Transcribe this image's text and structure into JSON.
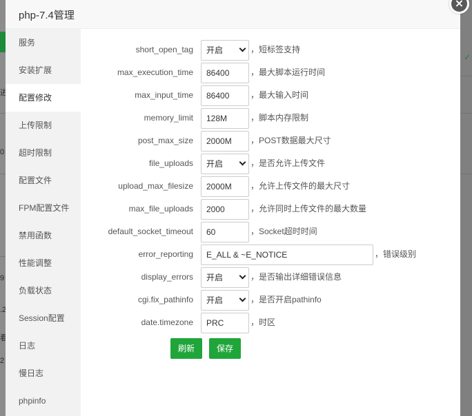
{
  "title": "php-7.4管理",
  "close_symbol": "×",
  "sidebar": {
    "items": [
      {
        "label": "服务"
      },
      {
        "label": "安装扩展"
      },
      {
        "label": "配置修改"
      },
      {
        "label": "上传限制"
      },
      {
        "label": "超时限制"
      },
      {
        "label": "配置文件"
      },
      {
        "label": "FPM配置文件"
      },
      {
        "label": "禁用函数"
      },
      {
        "label": "性能调整"
      },
      {
        "label": "负载状态"
      },
      {
        "label": "Session配置"
      },
      {
        "label": "日志"
      },
      {
        "label": "慢日志"
      },
      {
        "label": "phpinfo"
      }
    ],
    "active": "配置修改"
  },
  "settings": [
    {
      "label": "short_open_tag",
      "value": "开启",
      "type": "select",
      "desc": "，短标签支持"
    },
    {
      "label": "max_execution_time",
      "value": "86400",
      "type": "input",
      "desc": "，最大脚本运行时间"
    },
    {
      "label": "max_input_time",
      "value": "86400",
      "type": "input",
      "desc": "，最大输入时间"
    },
    {
      "label": "memory_limit",
      "value": "128M",
      "type": "input",
      "desc": "，脚本内存限制"
    },
    {
      "label": "post_max_size",
      "value": "2000M",
      "type": "input",
      "desc": "，POST数据最大尺寸"
    },
    {
      "label": "file_uploads",
      "value": "开启",
      "type": "select",
      "desc": "，是否允许上传文件"
    },
    {
      "label": "upload_max_filesize",
      "value": "2000M",
      "type": "input",
      "desc": "，允许上传文件的最大尺寸"
    },
    {
      "label": "max_file_uploads",
      "value": "2000",
      "type": "input",
      "desc": "，允许同时上传文件的最大数量"
    },
    {
      "label": "default_socket_timeout",
      "value": "60",
      "type": "input",
      "desc": "，Socket超时时间"
    },
    {
      "label": "error_reporting",
      "value": "E_ALL & ~E_NOTICE",
      "type": "wide",
      "desc": "，错误级别"
    },
    {
      "label": "display_errors",
      "value": "开启",
      "type": "select",
      "desc": "，是否输出详细错误信息"
    },
    {
      "label": "cgi.fix_pathinfo",
      "value": "开启",
      "type": "select",
      "desc": "，是否开启pathinfo"
    },
    {
      "label": "date.timezone",
      "value": "PRC",
      "type": "input",
      "desc": "，时区"
    }
  ],
  "buttons": {
    "refresh": "刷新",
    "save": "保存"
  },
  "background_fragments": [
    "进",
    "0",
    "9",
    ".2",
    "看",
    "2"
  ],
  "colors": {
    "accent": "#20a53a",
    "sidebar_bg": "#f2f2f2",
    "header_bg": "#f8f8f8"
  }
}
